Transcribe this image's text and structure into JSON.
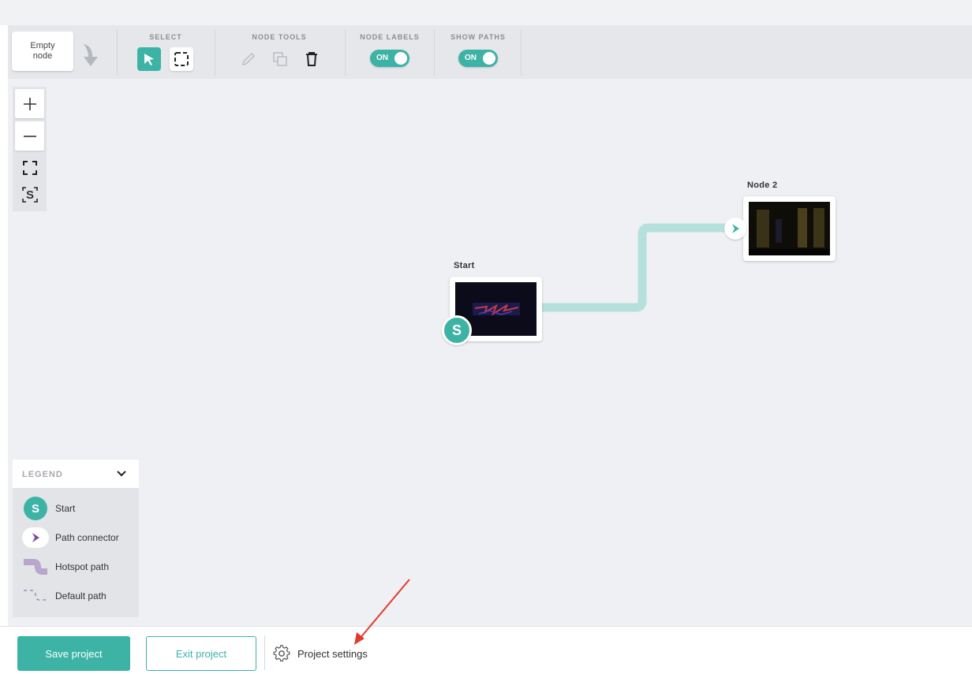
{
  "toolbar": {
    "empty_node_label": "Empty node",
    "select_title": "SELECT",
    "node_tools_title": "NODE TOOLS",
    "node_labels_title": "NODE LABELS",
    "show_paths_title": "SHOW PATHS",
    "node_labels_toggle": "ON",
    "show_paths_toggle": "ON"
  },
  "zoom": {
    "zoom_in": "+",
    "zoom_out": "—",
    "start_glyph": "S"
  },
  "graph": {
    "nodes": [
      {
        "label": "Start"
      },
      {
        "label": "Node 2"
      }
    ],
    "start_badge": "S"
  },
  "legend": {
    "title": "LEGEND",
    "items": [
      {
        "label": "Start",
        "icon": "start-badge-icon",
        "badge": "S"
      },
      {
        "label": "Path connector",
        "icon": "path-connector-icon"
      },
      {
        "label": "Hotspot path",
        "icon": "hotspot-path-icon"
      },
      {
        "label": "Default path",
        "icon": "default-path-icon"
      }
    ]
  },
  "footer": {
    "save_label": "Save project",
    "exit_label": "Exit project",
    "settings_label": "Project settings"
  },
  "colors": {
    "accent": "#3db3a5",
    "path": "#b5e0dc",
    "connector_purple": "#7b4e9e",
    "annotation_arrow": "#e23b2e"
  }
}
